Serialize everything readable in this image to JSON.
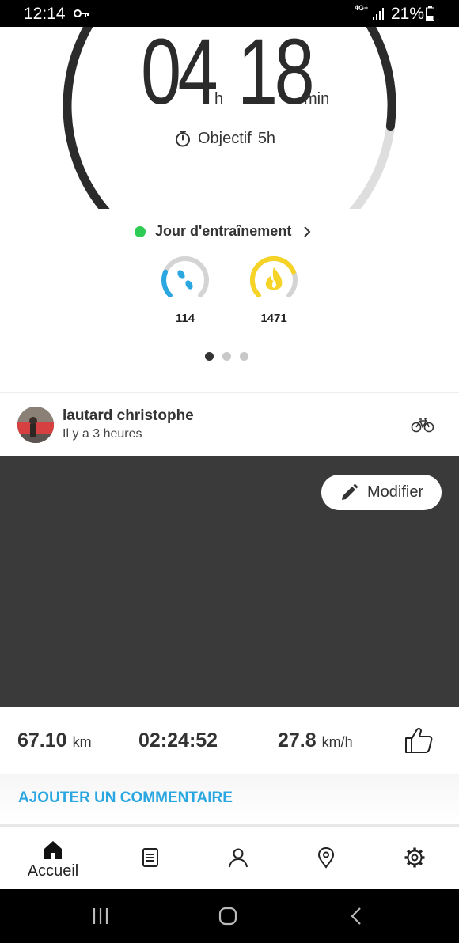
{
  "status_bar": {
    "time": "12:14",
    "network": "4G+",
    "battery": "21%"
  },
  "summary": {
    "hours": "04",
    "hours_unit": "h",
    "minutes": "18",
    "minutes_unit": "min",
    "goal_label": "Objectif",
    "goal_value": "5h",
    "progress_fraction": 0.86
  },
  "training_day": {
    "label": "Jour d'entraînement",
    "status_color": "#2ecc54"
  },
  "metrics": [
    {
      "icon": "steps-icon",
      "value": "114",
      "color": "#2aa6e0",
      "progress_fraction": 0.25
    },
    {
      "icon": "calories-flame-icon",
      "value": "1471",
      "color": "#f5d327",
      "progress_fraction": 0.75
    }
  ],
  "pager": {
    "count": 3,
    "active": 1
  },
  "post": {
    "author": "lautard christophe",
    "time_ago": "Il y a 3 heures",
    "activity_icon": "bicycle-icon",
    "edit_label": "Modifier",
    "stats": {
      "distance": "67.10",
      "distance_unit": "km",
      "duration": "02:24:52",
      "speed": "27.8",
      "speed_unit": "km/h"
    },
    "comment_label": "AJOUTER UN COMMENTAIRE"
  },
  "bottom_nav": {
    "home_label": "Accueil",
    "items": [
      "home-icon",
      "journal-icon",
      "profile-icon",
      "map-pin-icon",
      "settings-gear-icon"
    ]
  },
  "colors": {
    "accent": "#2aa6e0",
    "dark": "#2b2b2b",
    "media_bg": "#3a3a3a"
  }
}
